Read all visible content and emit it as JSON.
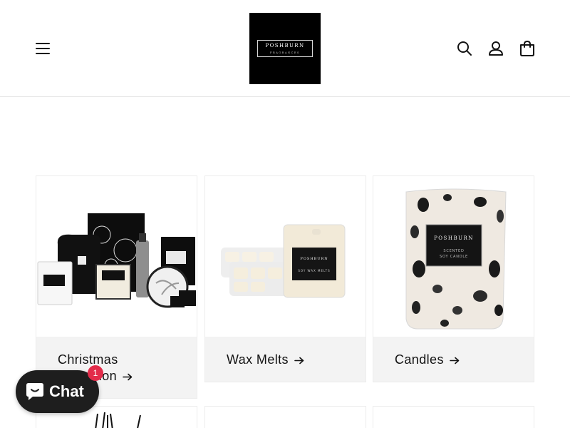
{
  "header": {
    "logo": {
      "name": "POSHBURN",
      "sub": "FRAGRANCES"
    },
    "icons": [
      "menu-icon",
      "search-icon",
      "account-icon",
      "cart-icon"
    ]
  },
  "collections": [
    {
      "title": "Christmas Collection",
      "line1": "Christmas",
      "line2": "Collection"
    },
    {
      "title": "Wax Melts"
    },
    {
      "title": "Candles"
    }
  ],
  "chat": {
    "label": "Chat",
    "badge": "1"
  },
  "colors": {
    "chat_bg": "#1e1e1e",
    "badge": "#e32c4a",
    "card_bg": "#f3f3f3"
  }
}
